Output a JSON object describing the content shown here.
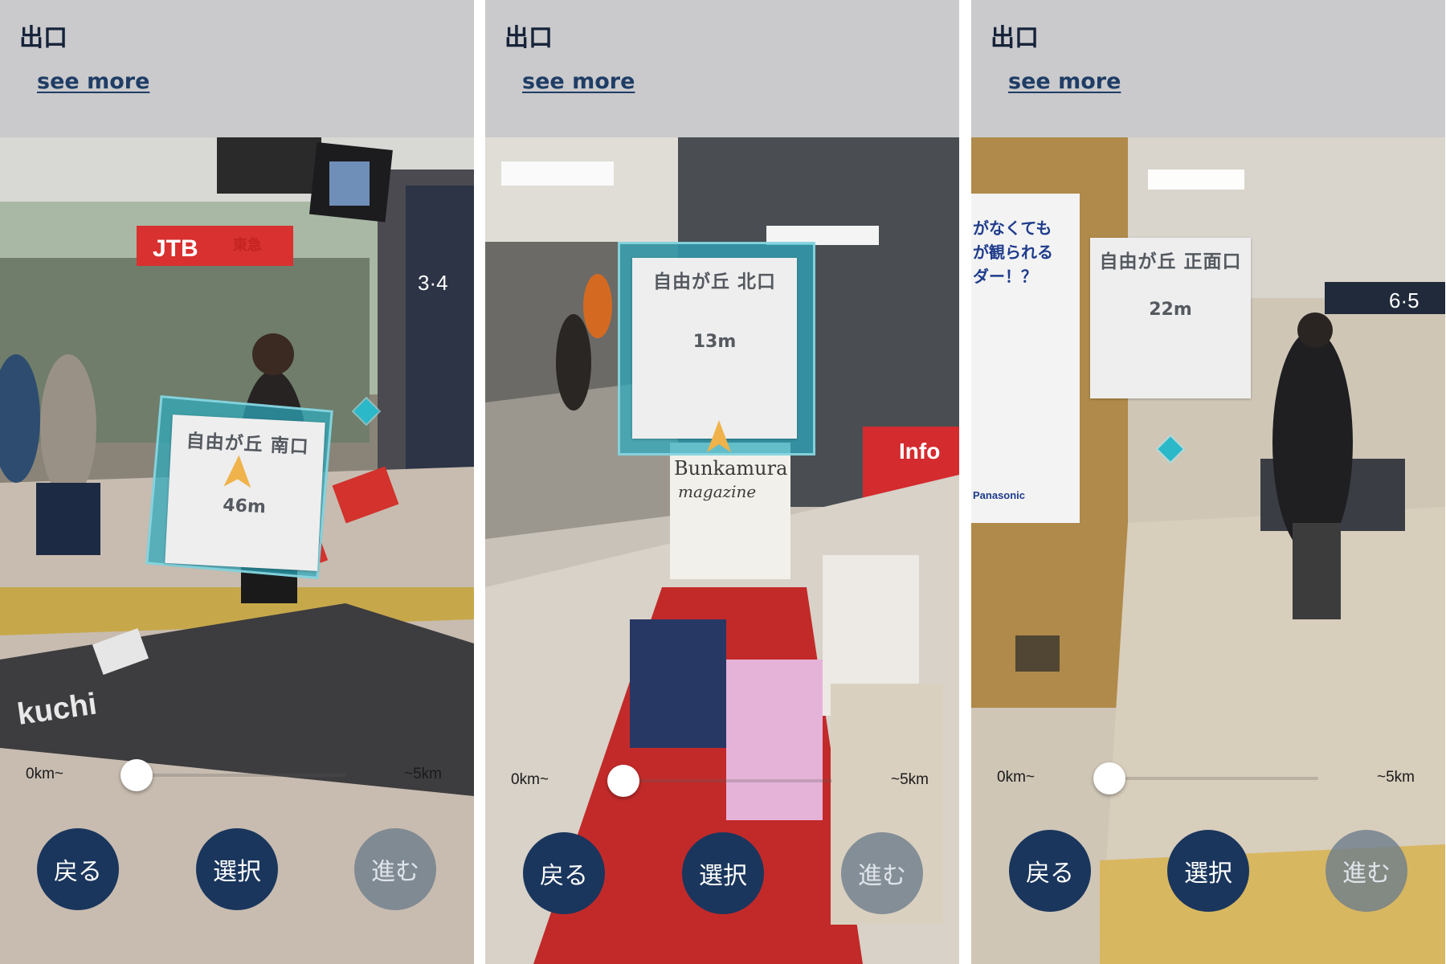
{
  "screens": [
    {
      "header": {
        "title": "出口",
        "see_more": "see more"
      },
      "marker": {
        "name": "自由が丘 南口",
        "distance": "46m"
      },
      "slider": {
        "min_label": "0km~",
        "max_label": "~5km",
        "value_fraction": 0.06
      },
      "buttons": {
        "back": "戻る",
        "select": "選択",
        "next": "進む"
      },
      "scene_text": {
        "sign_brand": "JTB",
        "sign_store": "東急",
        "platform": "3·4",
        "floor_text": "kuchi"
      }
    },
    {
      "header": {
        "title": "出口",
        "see_more": "see more"
      },
      "marker": {
        "name": "自由が丘 北口",
        "distance": "13m"
      },
      "slider": {
        "min_label": "0km~",
        "max_label": "~5km",
        "value_fraction": 0.06
      },
      "buttons": {
        "back": "戻る",
        "select": "選択",
        "next": "進む"
      },
      "scene_text": {
        "info_sign": "Info",
        "magazine": "Bunkamura",
        "magazine_sub": "magazine"
      }
    },
    {
      "header": {
        "title": "出口",
        "see_more": "see more"
      },
      "marker": {
        "name": "自由が丘 正面口",
        "distance": "22m"
      },
      "slider": {
        "min_label": "0km~",
        "max_label": "~5km",
        "value_fraction": 0.06
      },
      "buttons": {
        "back": "戻る",
        "select": "選択",
        "next": "進む"
      },
      "scene_text": {
        "ad_line1": "がなくても",
        "ad_line2": "が観られる",
        "ad_line3": "ダー！？",
        "ad_brand": "Panasonic",
        "platform": "6·5"
      }
    }
  ],
  "colors": {
    "button": "#1a365d",
    "button_disabled": "#6e7d8c",
    "marker_frame": "#2daabe",
    "marker_arrow": "#f0b24a",
    "header_bg": "#cacacc"
  }
}
